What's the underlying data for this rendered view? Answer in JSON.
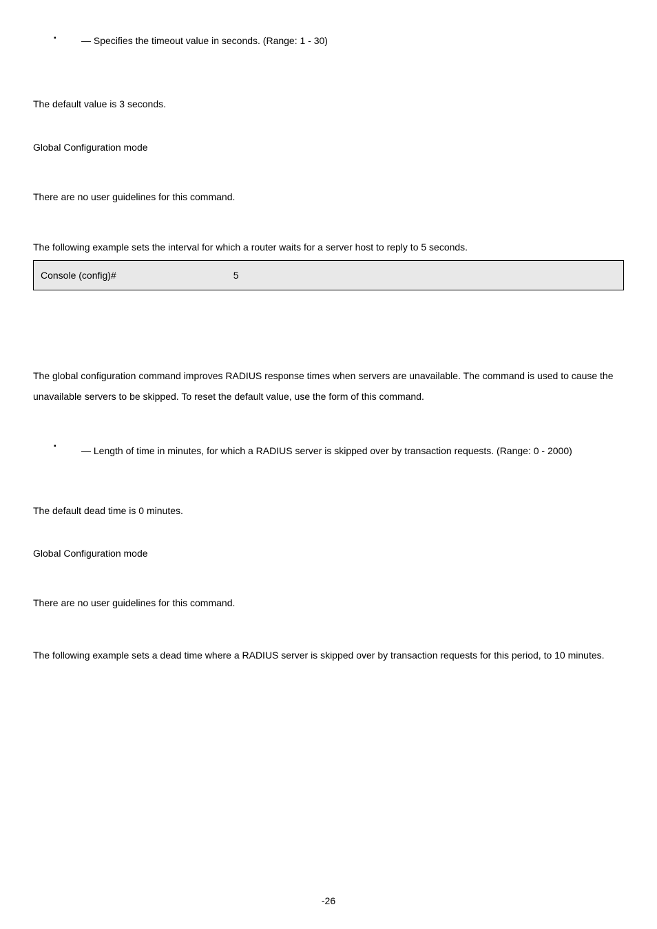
{
  "param1": {
    "text": " — Specifies the timeout value in seconds. (Range: 1 - 30)"
  },
  "default1": "The default value is 3 seconds.",
  "mode1": "Global Configuration mode",
  "guidelines1": "There are no user guidelines for this command.",
  "example1_intro": "The following example sets the interval for which a router waits for a server host to reply to 5 seconds.",
  "code1_prompt": "Console (config)#",
  "code1_val": "5",
  "desc2_a": "The ",
  "desc2_b": " global configuration command improves RADIUS response times when servers are unavailable. The command is used to cause the unavailable servers to be skipped. To reset the default value, use the ",
  "desc2_c": " form of this command.",
  "param2": {
    "text": " — Length of time in minutes, for which a RADIUS server is skipped over by transaction requests. (Range: 0 - 2000)"
  },
  "default2": "The default dead time is 0 minutes.",
  "mode2": "Global Configuration mode",
  "guidelines2": "There are no user guidelines for this command.",
  "example2_intro": "The following example sets a dead time where a RADIUS server is skipped over by transaction requests for this period, to 10 minutes.",
  "page_num": "-26"
}
